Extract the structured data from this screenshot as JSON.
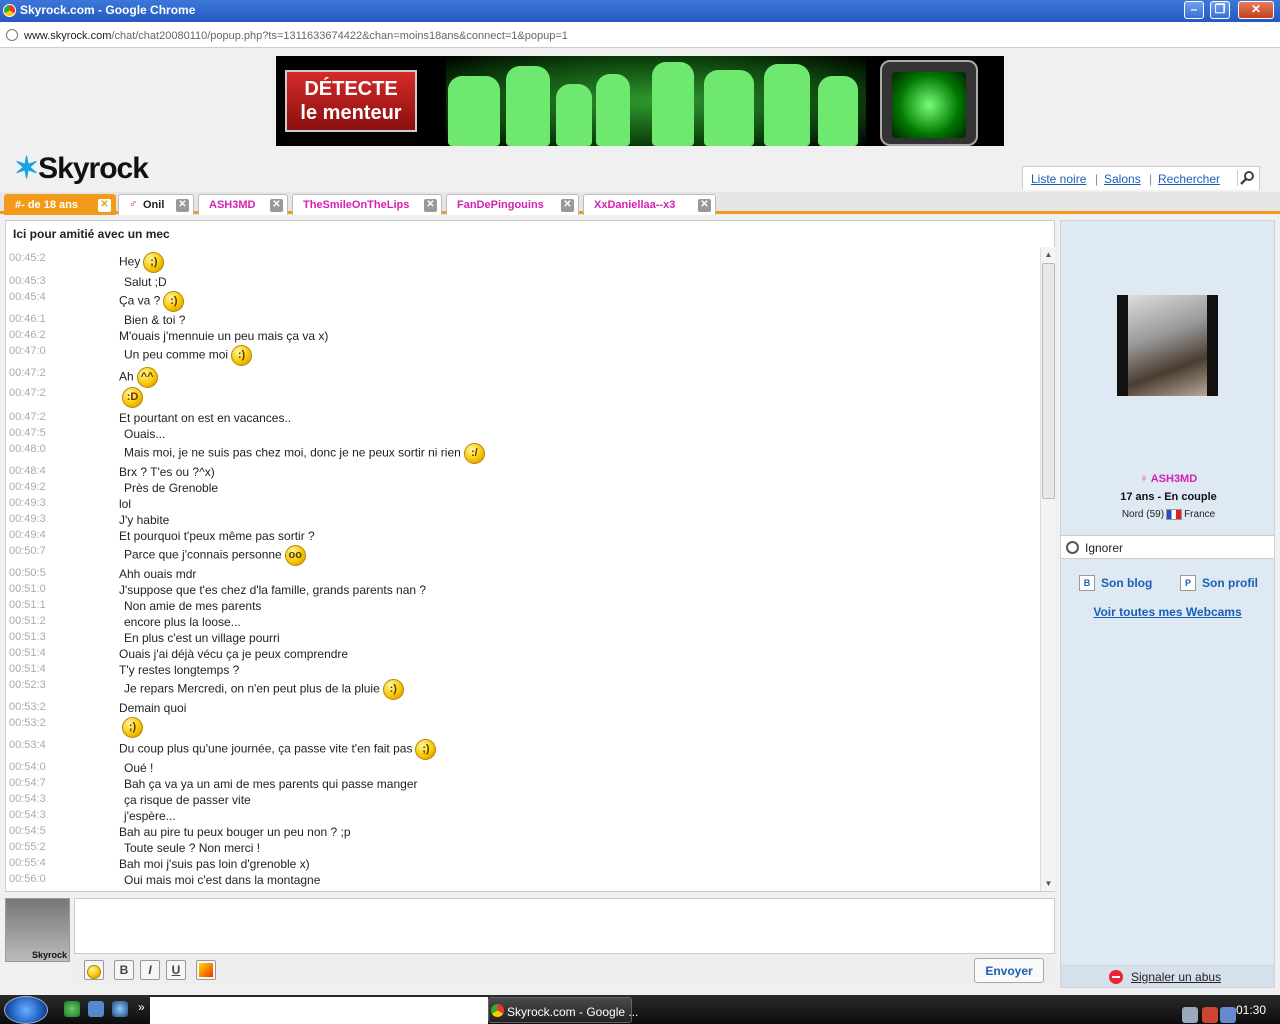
{
  "window": {
    "title": "Skyrock.com - Google Chrome",
    "url_domain": "www.skyrock.com",
    "url_path": "/chat/chat20080110/popup.php?ts=1311633674422&chan=moins18ans&connect=1&popup=1"
  },
  "banner": {
    "text_line1": "DÉTECTE",
    "text_line2": "le menteur"
  },
  "logo": "Skyrock",
  "toplinks": [
    "Liste noire",
    "Salons",
    "Rechercher"
  ],
  "tabs": [
    {
      "label": "#- de 18 ans",
      "active": true
    },
    {
      "label": "Onil",
      "active": false
    },
    {
      "label": "ASH3MD",
      "active": false
    },
    {
      "label": "TheSmileOnTheLips",
      "active": false
    },
    {
      "label": "FanDePingouins",
      "active": false
    },
    {
      "label": "XxDaniellaa--x3",
      "active": false
    }
  ],
  "chat": {
    "title": "Ici pour amitié avec un mec",
    "messages": [
      {
        "time": "00:45:2",
        "text": "Hey",
        "smiley": "wink"
      },
      {
        "time": "00:45:3",
        "text": "Salut ;D",
        "smiley": ""
      },
      {
        "time": "00:45:4",
        "text": "Ça va ?",
        "smiley": "smile"
      },
      {
        "time": "00:46:1",
        "text": "Bien & toi ?",
        "smiley": ""
      },
      {
        "time": "00:46:2",
        "text": "M'ouais j'mennuie un peu mais ça va x)",
        "smiley": ""
      },
      {
        "time": "00:47:0",
        "text": "Un peu comme moi",
        "smiley": "smile"
      },
      {
        "time": "00:47:2",
        "text": "Ah",
        "smiley": "happy"
      },
      {
        "time": "00:47:2",
        "text": "",
        "smiley": "grin"
      },
      {
        "time": "00:47:2",
        "text": "Et pourtant on est en vacances..",
        "smiley": ""
      },
      {
        "time": "00:47:5",
        "text": "Ouais...",
        "smiley": ""
      },
      {
        "time": "00:48:0",
        "text": "Mais moi, je ne suis pas chez moi, donc je ne peux sortir ni rien",
        "smiley": "unsure"
      },
      {
        "time": "00:48:4",
        "text": "Brx ? T'es ou ?^x)",
        "smiley": ""
      },
      {
        "time": "00:49:2",
        "text": "Près de Grenoble",
        "smiley": ""
      },
      {
        "time": "00:49:3",
        "text": "lol",
        "smiley": ""
      },
      {
        "time": "00:49:3",
        "text": "J'y habite",
        "smiley": ""
      },
      {
        "time": "00:49:4",
        "text": "Et pourquoi t'peux même pas sortir ?",
        "smiley": ""
      },
      {
        "time": "00:50:7",
        "text": "Parce que j'connais personne",
        "smiley": "eyes"
      },
      {
        "time": "00:50:5",
        "text": "Ahh ouais mdr",
        "smiley": ""
      },
      {
        "time": "00:51:0",
        "text": "J'suppose que t'es chez d'la famille, grands parents nan ?",
        "smiley": ""
      },
      {
        "time": "00:51:1",
        "text": "Non amie de mes parents",
        "smiley": ""
      },
      {
        "time": "00:51:2",
        "text": "encore plus la loose...",
        "smiley": ""
      },
      {
        "time": "00:51:3",
        "text": "En plus c'est un village pourri",
        "smiley": ""
      },
      {
        "time": "00:51:4",
        "text": "Ouais j'ai déjà vécu ça je peux comprendre",
        "smiley": ""
      },
      {
        "time": "00:51:4",
        "text": "T'y restes longtemps ?",
        "smiley": ""
      },
      {
        "time": "00:52:3",
        "text": "Je repars Mercredi, on n'en peut plus de la pluie",
        "smiley": "smile"
      },
      {
        "time": "00:53:2",
        "text": "Demain quoi",
        "smiley": ""
      },
      {
        "time": "00:53:2",
        "text": "",
        "smiley": "wink"
      },
      {
        "time": "00:53:4",
        "text": "Du coup plus qu'une journée, ça passe vite t'en fait pas",
        "smiley": "wink"
      },
      {
        "time": "00:54:0",
        "text": "Oué !",
        "smiley": ""
      },
      {
        "time": "00:54:7",
        "text": "Bah ça va ya un ami de mes parents qui passe manger",
        "smiley": ""
      },
      {
        "time": "00:54:3",
        "text": "ça risque de passer vite",
        "smiley": ""
      },
      {
        "time": "00:54:3",
        "text": "j'espère...",
        "smiley": ""
      },
      {
        "time": "00:54:5",
        "text": "Bah au pire tu peux bouger un peu non ? ;p",
        "smiley": ""
      },
      {
        "time": "00:55:2",
        "text": "Toute seule ? Non merci !",
        "smiley": ""
      },
      {
        "time": "00:55:4",
        "text": "Bah moi j'suis pas loin d'grenoble x)",
        "smiley": ""
      },
      {
        "time": "00:56:0",
        "text": "Oui mais moi c'est dans la montagne",
        "smiley": ""
      }
    ]
  },
  "input": {
    "avatar_label": "Skyrock",
    "tools": [
      "☺",
      "B",
      "I",
      "U"
    ],
    "send_label": "Envoyer"
  },
  "profile": {
    "username": "ASH3MD",
    "info": "17 ans - En couple",
    "location": "Nord (59)",
    "country": "France",
    "ignore_label": "Ignorer",
    "blog_label": "Son blog",
    "profile_label": "Son profil",
    "webcams_label": "Voir toutes mes Webcams",
    "abuse_label": "Signaler un abus"
  },
  "taskbar": {
    "task_label": "Skyrock.com - Google ...",
    "clock": "01:30"
  }
}
